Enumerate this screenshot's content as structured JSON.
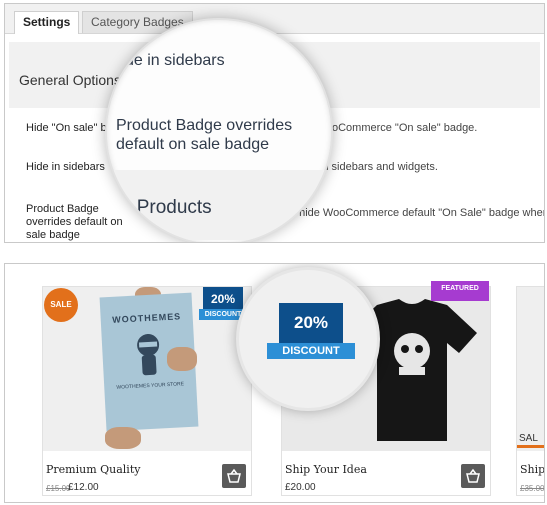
{
  "settings": {
    "tabs": [
      {
        "label": "Settings",
        "active": true
      },
      {
        "label": "Category Badges",
        "active": false
      }
    ],
    "section_title": "General Options",
    "rows": [
      {
        "label": "Hide \"On sale\" b",
        "description": "ult WooCommerce \"On sale\" badge."
      },
      {
        "label": "Hide in sidebars",
        "description": "dges in sidebars and widgets."
      },
      {
        "label": "Product Badge overrides default on sale badge",
        "description": "vant to hide WooCommerce default \"On Sale\" badge when th"
      }
    ],
    "magnifier": {
      "line1": "de in sidebars",
      "line2": "Product Badge overrides",
      "line3": "default on sale badge",
      "line4": "ent Products"
    }
  },
  "products": {
    "items": [
      {
        "name": "Premium Quality",
        "price_old": "£15.00",
        "price_new": "£12.00",
        "badge": "SALE",
        "discount": {
          "percent": "20%",
          "label": "DISCOUNT"
        }
      },
      {
        "name": "Ship Your Idea",
        "price_new": "£20.00",
        "badge": "FEATURED"
      },
      {
        "name": "Ship",
        "price_old": "£35.00",
        "partial_label": "SAL"
      }
    ],
    "poster": {
      "title": "WOOTHEMES",
      "subtitle": "WOOTHEMES YOUR STORE"
    },
    "magnifier": {
      "percent": "20%",
      "label": "DISCOUNT"
    },
    "colors": {
      "sale": "#e2701b",
      "discount_dark": "#0d4f8b",
      "discount_ribbon": "#2c8fd6",
      "featured": "#a63bd0"
    }
  }
}
